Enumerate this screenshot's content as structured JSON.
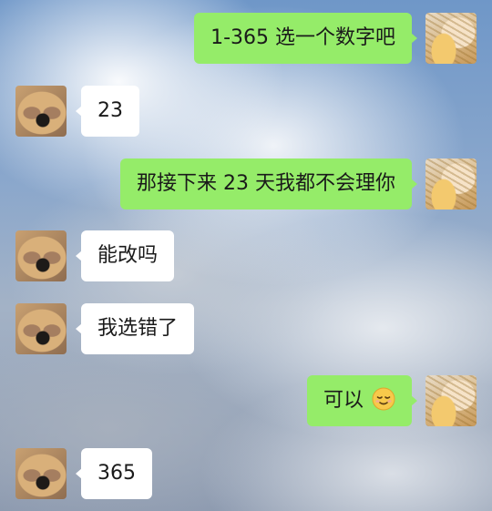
{
  "messages": [
    {
      "side": "right",
      "sender": "cat",
      "text": "1-365 选一个数字吧"
    },
    {
      "side": "left",
      "sender": "dog",
      "text": "23"
    },
    {
      "side": "right",
      "sender": "cat",
      "text": "那接下来 23 天我都不会理你"
    },
    {
      "side": "left",
      "sender": "dog",
      "text": "能改吗"
    },
    {
      "side": "left",
      "sender": "dog",
      "text": "我选错了"
    },
    {
      "side": "right",
      "sender": "cat",
      "text": "可以",
      "emoji": "relieved-face-emoji"
    },
    {
      "side": "left",
      "sender": "dog",
      "text": "365"
    }
  ],
  "avatars": {
    "cat": "cat-avatar",
    "dog": "dog-avatar"
  },
  "colors": {
    "outgoing_bubble": "#95ec69",
    "incoming_bubble": "#ffffff",
    "text": "#1a1a1a"
  }
}
